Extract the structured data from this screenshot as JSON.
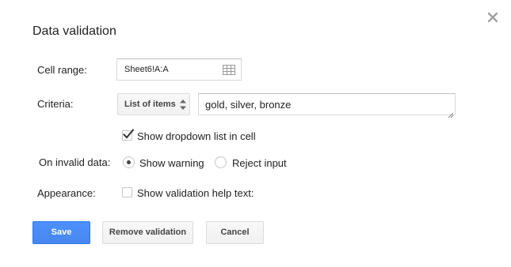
{
  "dialog": {
    "title": "Data validation",
    "close_icon": "close-x-icon"
  },
  "cell_range": {
    "label": "Cell range:",
    "value": "Sheet6!A:A",
    "icon": "grid-select-range-icon"
  },
  "criteria": {
    "label": "Criteria:",
    "type_selected": "List of items",
    "type_icon": "up-down-arrows-icon",
    "value": "gold, silver, bronze",
    "show_dropdown": {
      "label": "Show dropdown list in cell",
      "checked": true
    }
  },
  "on_invalid": {
    "label": "On invalid data:",
    "options": [
      {
        "label": "Show warning",
        "selected": true
      },
      {
        "label": "Reject input",
        "selected": false
      }
    ]
  },
  "appearance": {
    "label": "Appearance:",
    "help_text": {
      "label": "Show validation help text:",
      "checked": false
    }
  },
  "buttons": {
    "save": "Save",
    "remove": "Remove validation",
    "cancel": "Cancel"
  },
  "colors": {
    "primary": "#4d90fe",
    "primary_border": "#3079ed",
    "text": "#222222",
    "icon_gray": "#999999"
  }
}
